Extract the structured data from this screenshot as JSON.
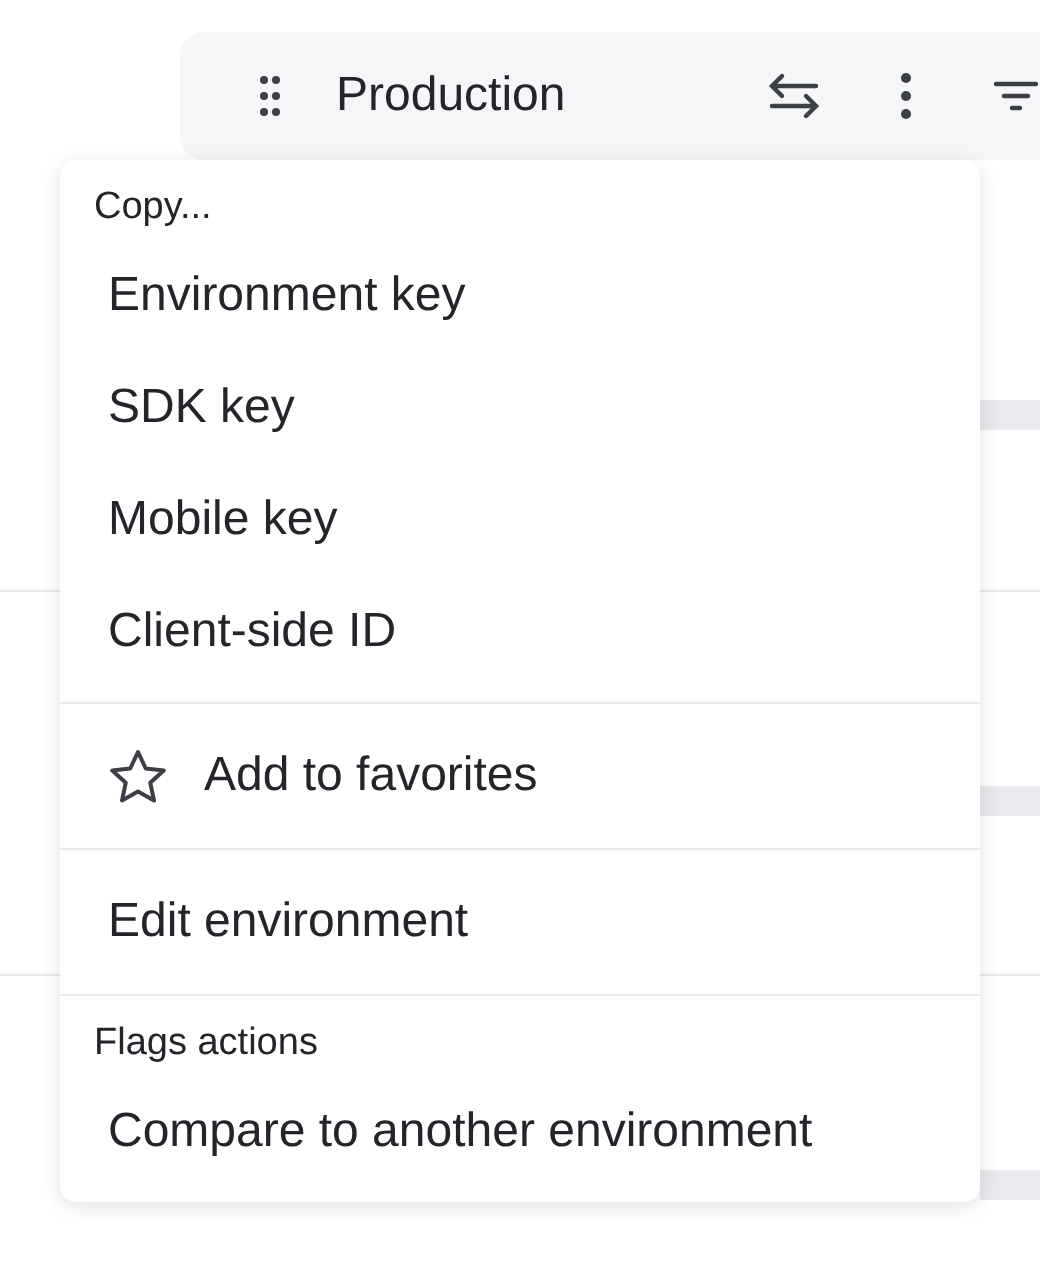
{
  "header": {
    "title": "Production"
  },
  "menu": {
    "sections": [
      {
        "heading": "Copy...",
        "items": [
          {
            "label": "Environment key",
            "kind": "plain"
          },
          {
            "label": "SDK key",
            "kind": "plain"
          },
          {
            "label": "Mobile key",
            "kind": "plain"
          },
          {
            "label": "Client-side ID",
            "kind": "plain"
          }
        ]
      },
      {
        "items": [
          {
            "label": "Add to favorites",
            "kind": "favorite"
          }
        ]
      },
      {
        "items": [
          {
            "label": "Edit environment",
            "kind": "plain"
          }
        ]
      },
      {
        "heading": "Flags actions",
        "items": [
          {
            "label": "Compare to another environment",
            "kind": "plain"
          }
        ]
      }
    ]
  }
}
